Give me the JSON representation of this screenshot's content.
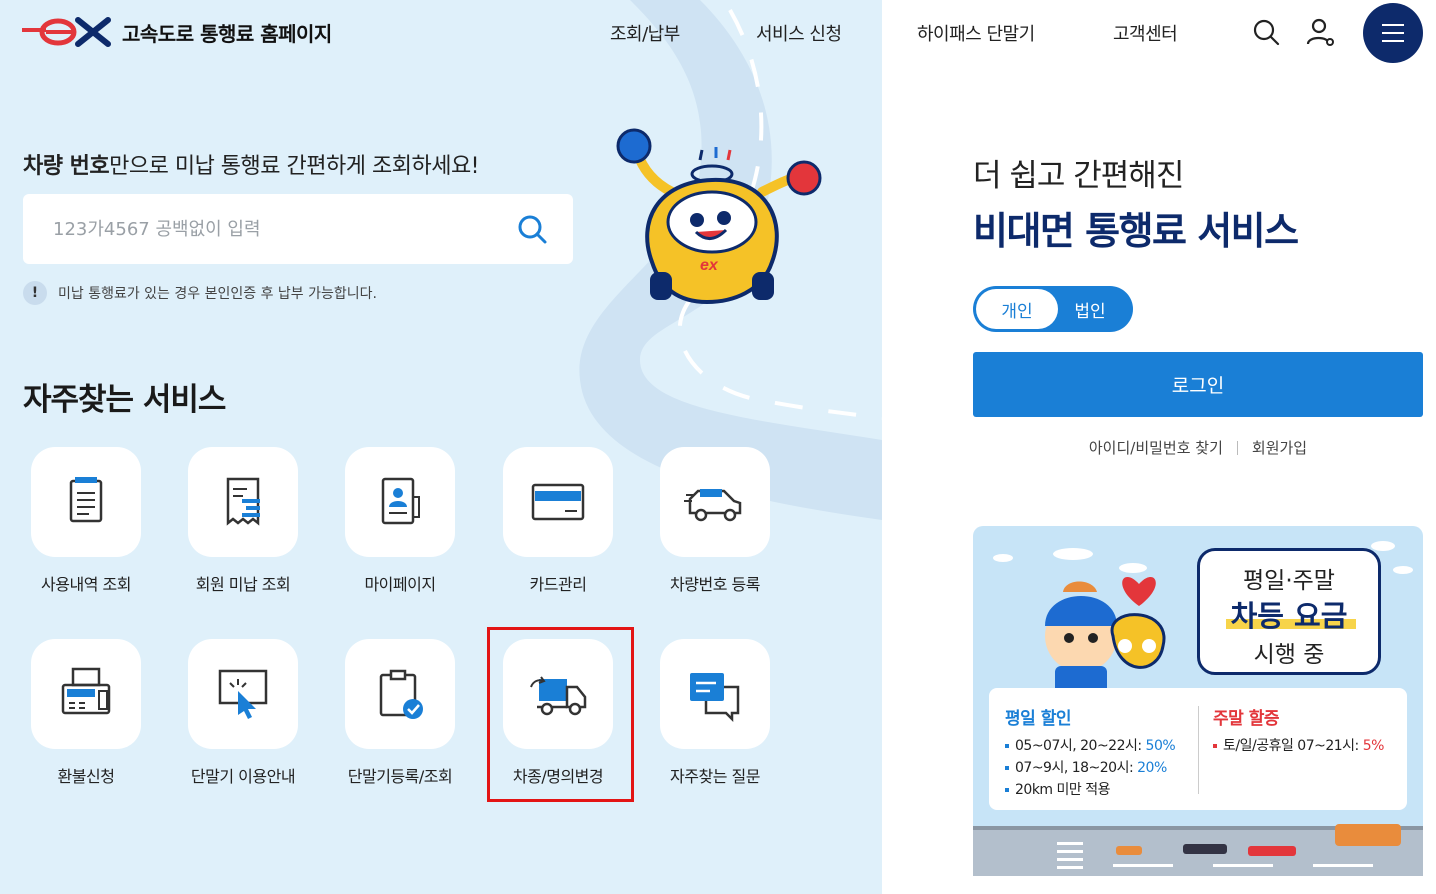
{
  "header": {
    "logo_text": "ex",
    "site_title": "고속도로 통행료 홈페이지",
    "nav": [
      "조회/납부",
      "서비스 신청",
      "하이패스 단말기",
      "고객센터"
    ],
    "icons": [
      "search-icon",
      "user-icon",
      "menu-icon"
    ]
  },
  "lookup": {
    "title_bold": "차량 번호",
    "title_rest": "만으로 미납 통행료 간편하게 조회하세요!",
    "placeholder": "123가4567 공백없이 입력",
    "notice_icon": "!",
    "notice": "미납 통행료가 있는 경우 본인인증 후 납부 가능합니다."
  },
  "frequent": {
    "title": "자주찾는 서비스",
    "items": [
      {
        "label": "사용내역 조회",
        "icon": "document-list-icon"
      },
      {
        "label": "회원 미납 조회",
        "icon": "receipt-icon"
      },
      {
        "label": "마이페이지",
        "icon": "profile-card-icon"
      },
      {
        "label": "카드관리",
        "icon": "credit-card-icon"
      },
      {
        "label": "차량번호 등록",
        "icon": "vehicle-icon"
      },
      {
        "label": "환불신청",
        "icon": "fax-icon"
      },
      {
        "label": "단말기 이용안내",
        "icon": "touch-screen-icon"
      },
      {
        "label": "단말기등록/조회",
        "icon": "clipboard-check-icon"
      },
      {
        "label": "차종/명의변경",
        "icon": "truck-change-icon"
      },
      {
        "label": "자주찾는 질문",
        "icon": "chat-bubble-icon"
      }
    ]
  },
  "contactless": {
    "heading1": "더 쉽고 간편해진",
    "heading2": "비대면 통행료 서비스",
    "toggle": {
      "personal": "개인",
      "corporate": "법인",
      "selected": "개인"
    },
    "login": "로그인",
    "find_account": "아이디/비밀번호 찾기",
    "signup": "회원가입"
  },
  "banner": {
    "bubble_line1": "평일·주말",
    "bubble_line2": "차등 요금",
    "bubble_line3": "시행 중",
    "weekday_title": "평일 할인",
    "weekday_lines": [
      {
        "text": "05~07시, 20~22시: ",
        "rate": "50%"
      },
      {
        "text": "07~9시, 18~20시: ",
        "rate": "20%"
      },
      {
        "text": "20km 미만 적용",
        "rate": ""
      }
    ],
    "weekend_title": "주말 할증",
    "weekend_lines": [
      {
        "text": "토/일/공휴일 07~21시: ",
        "rate": "5%"
      }
    ]
  },
  "colors": {
    "brand_navy": "#0d2a6b",
    "brand_red": "#e3363b",
    "primary_blue": "#1a7fd6",
    "left_panel_bg": "#dff0fa",
    "highlight_red": "#e31414"
  }
}
